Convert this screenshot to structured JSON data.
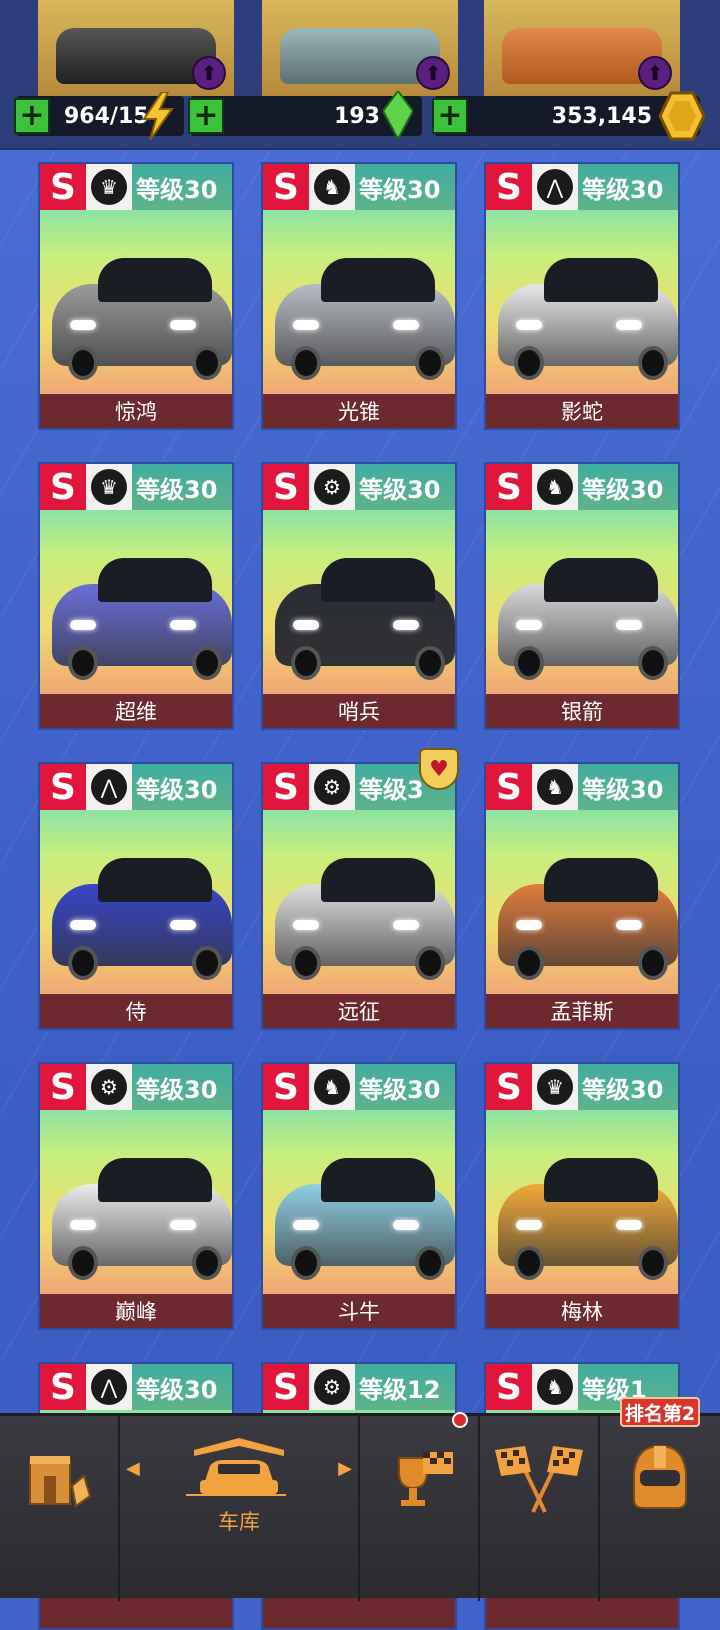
{
  "resources": {
    "energy": "964/15",
    "gems": "193",
    "coins": "353,145"
  },
  "cars": [
    {
      "rank": "S",
      "class_icon": "crown-icon",
      "level": "等级30",
      "name": "惊鸿",
      "body": "#9a9a9a"
    },
    {
      "rank": "S",
      "class_icon": "horse-icon",
      "level": "等级30",
      "name": "光锥",
      "body": "#b8bcc4"
    },
    {
      "rank": "S",
      "class_icon": "road-icon",
      "level": "等级30",
      "name": "影蛇",
      "body": "#e8e8ea"
    },
    {
      "rank": "S",
      "class_icon": "crown-icon",
      "level": "等级30",
      "name": "超维",
      "body": "#6a6fd8"
    },
    {
      "rank": "S",
      "class_icon": "wheel-icon",
      "level": "等级30",
      "name": "哨兵",
      "body": "#2a2d36"
    },
    {
      "rank": "S",
      "class_icon": "horse-icon",
      "level": "等级30",
      "name": "银箭",
      "body": "#d9d9dc"
    },
    {
      "rank": "S",
      "class_icon": "road-icon",
      "level": "等级30",
      "name": "侍",
      "body": "#3846c8"
    },
    {
      "rank": "S",
      "class_icon": "wheel-icon",
      "level": "等级3",
      "name": "远征",
      "body": "#dedede"
    },
    {
      "rank": "S",
      "class_icon": "horse-icon",
      "level": "等级30",
      "name": "孟菲斯",
      "body": "#e07d3c"
    },
    {
      "rank": "S",
      "class_icon": "wheel-icon",
      "level": "等级30",
      "name": "巅峰",
      "body": "#ececec"
    },
    {
      "rank": "S",
      "class_icon": "horse-icon",
      "level": "等级30",
      "name": "斗牛",
      "body": "#8fd0e6"
    },
    {
      "rank": "S",
      "class_icon": "crown-icon",
      "level": "等级30",
      "name": "梅林",
      "body": "#f1a93a"
    },
    {
      "rank": "S",
      "class_icon": "road-icon",
      "level": "等级30",
      "name": "",
      "body": "#999"
    },
    {
      "rank": "S",
      "class_icon": "wheel-icon",
      "level": "等级12",
      "name": "",
      "body": "#999"
    },
    {
      "rank": "S",
      "class_icon": "horse-icon",
      "level": "等级1",
      "name": "",
      "body": "#999"
    }
  ],
  "nav": {
    "garage_label": "车库",
    "rank_badge": "排名第2"
  },
  "colors": {
    "accent_orange": "#f2a340",
    "rank_red": "#e2163c",
    "plus_green": "#3ec23b"
  }
}
